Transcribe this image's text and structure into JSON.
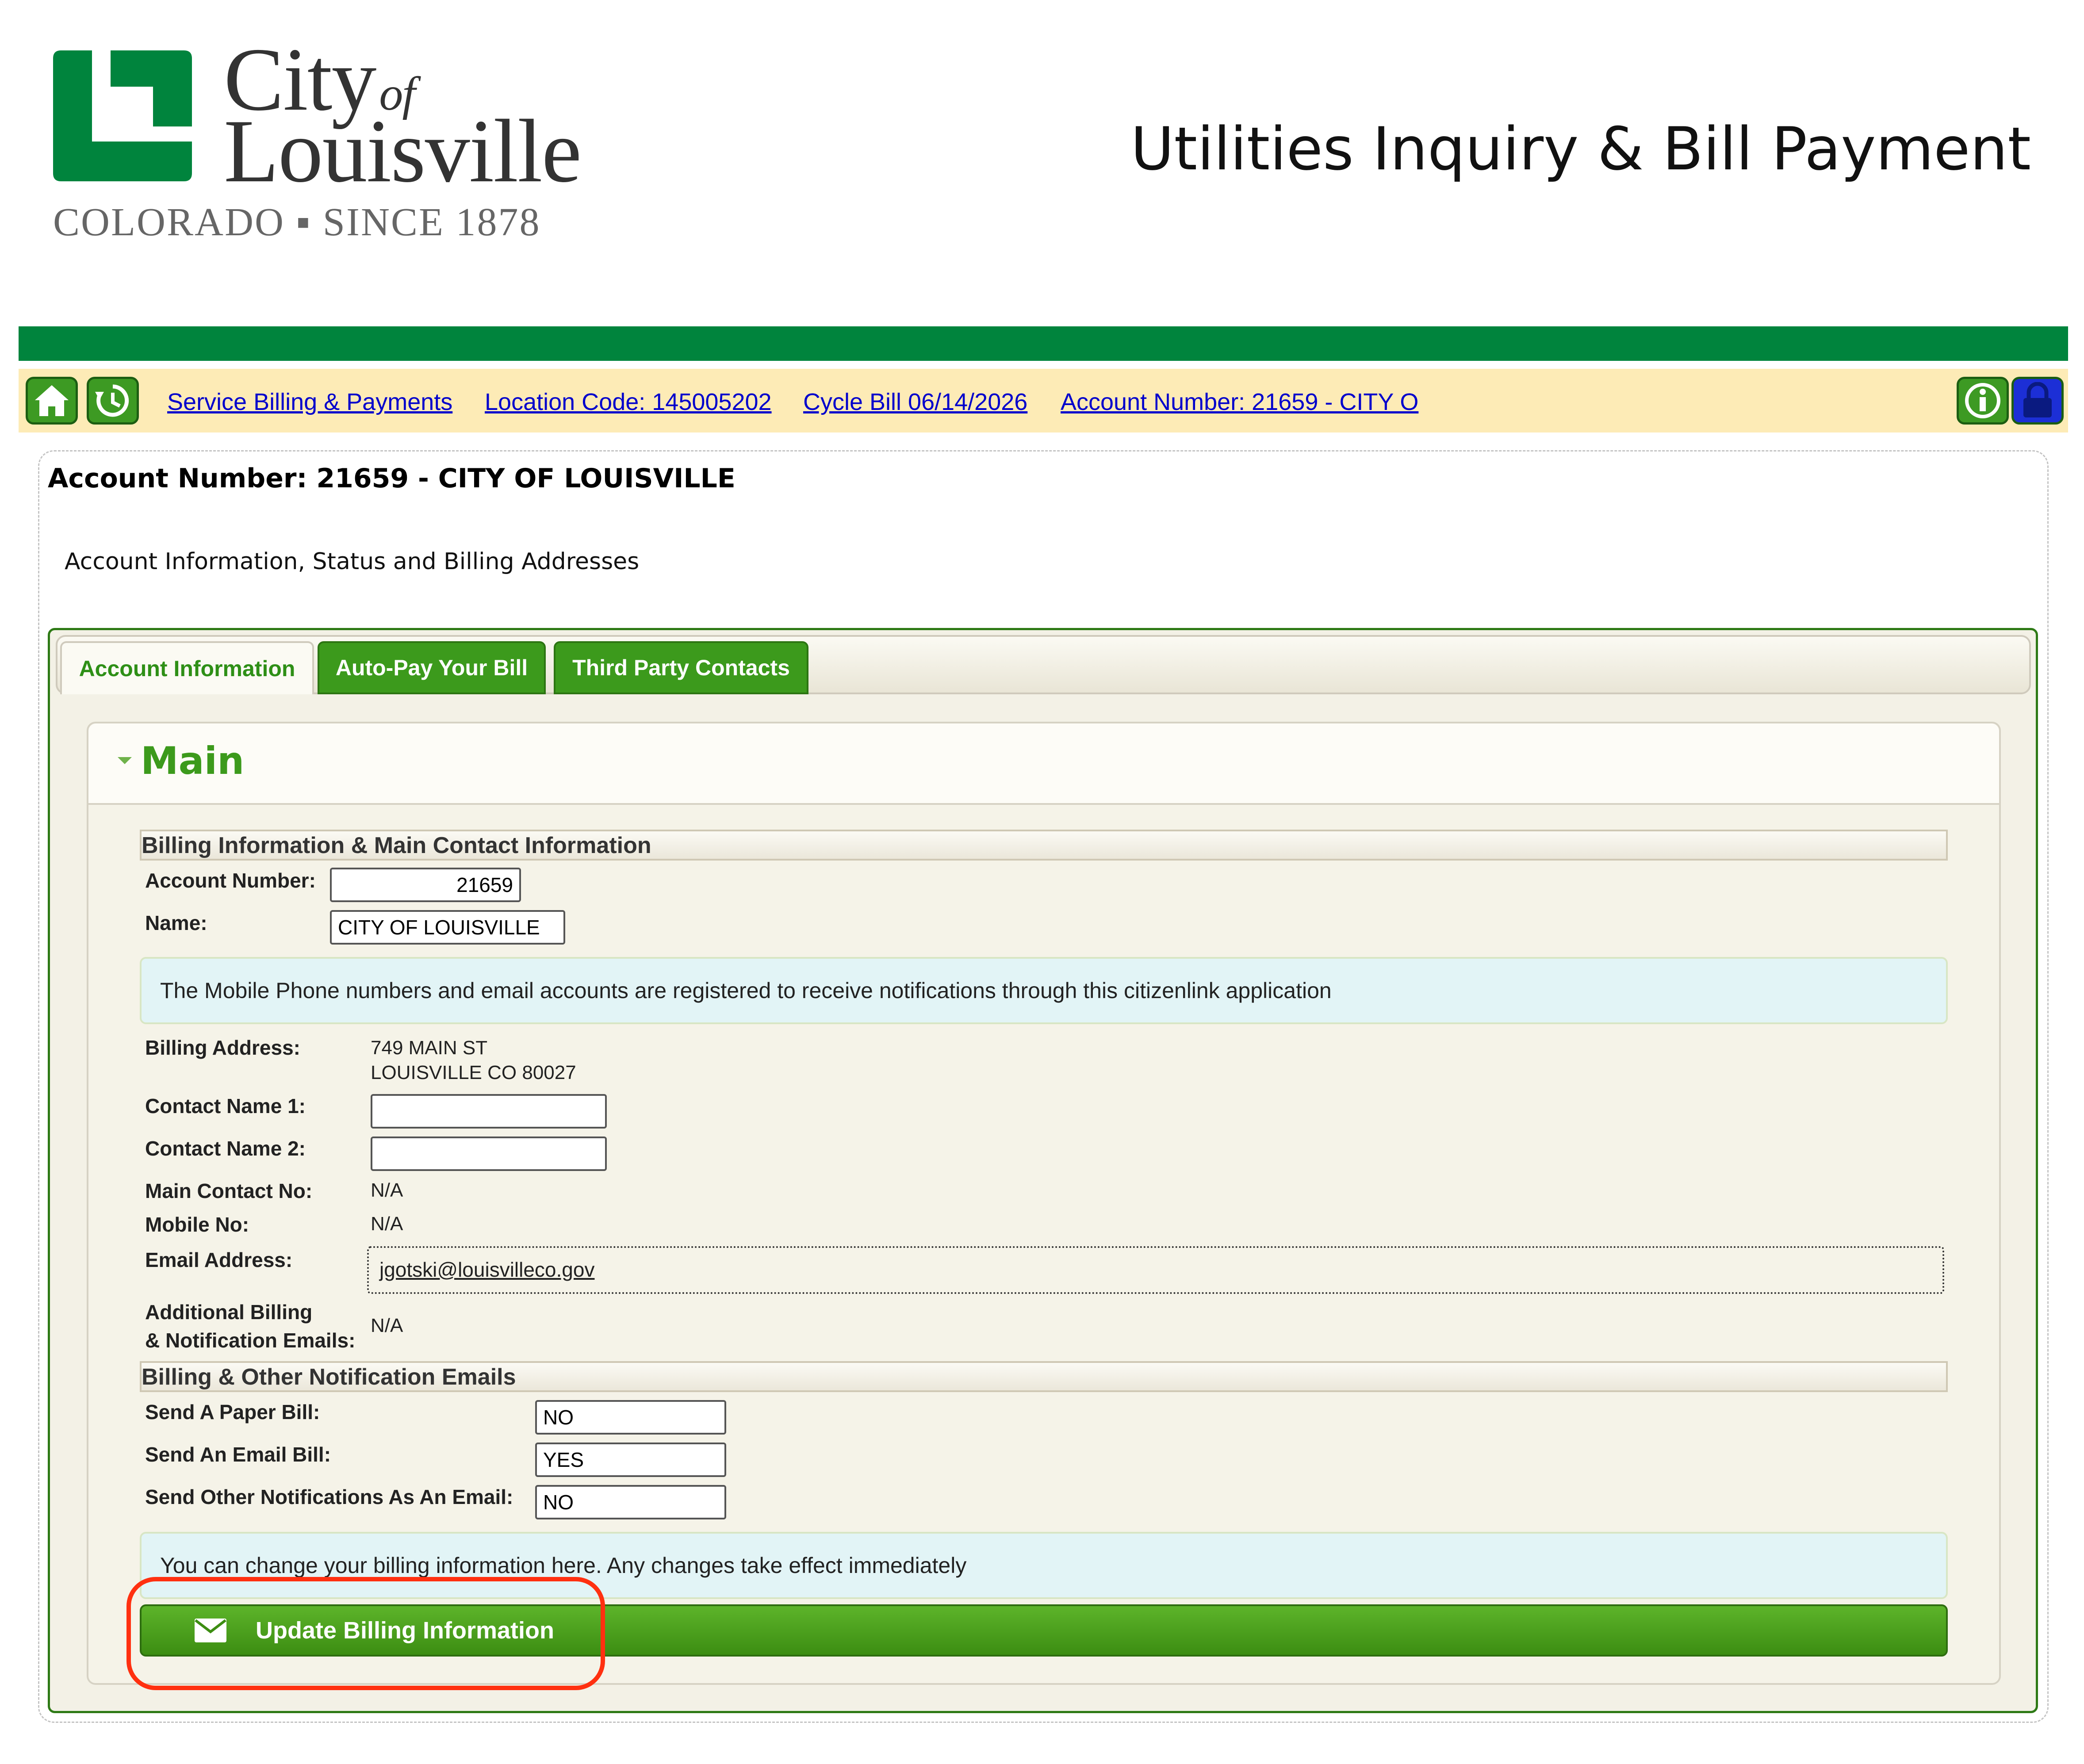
{
  "header": {
    "logo_city": "City",
    "logo_of": "of",
    "logo_louisville": "Louisville",
    "logo_tagline": "COLORADO ▪ SINCE 1878",
    "site_title": "Utilities Inquiry & Bill Payment"
  },
  "toolbar": {
    "home_icon": "home-icon",
    "history_icon": "history-icon",
    "info_icon": "info-icon",
    "lock_icon": "lock-icon",
    "crumbs": [
      "Service Billing & Payments",
      "Location Code: 145005202",
      "Cycle Bill 06/14/2026",
      "Account Number: 21659 - CITY O"
    ]
  },
  "account": {
    "heading": "Account Number: 21659 - CITY OF LOUISVILLE",
    "subheading": "Account Information, Status and Billing Addresses"
  },
  "tabs": [
    "Account Information",
    "Auto-Pay Your Bill",
    "Third Party Contacts"
  ],
  "main": {
    "title": "Main",
    "billing_section_title": "Billing Information & Main Contact Information",
    "labels": {
      "account_number": "Account Number:",
      "name": "Name:",
      "billing_address": "Billing Address:",
      "contact_name_1": "Contact Name 1:",
      "contact_name_2": "Contact Name 2:",
      "main_contact_no": "Main Contact No:",
      "mobile_no": "Mobile No:",
      "email_address": "Email Address:",
      "additional_line1": "Additional Billing",
      "additional_line2": "& Notification Emails:"
    },
    "values": {
      "account_number": "21659",
      "name": "CITY OF LOUISVILLE",
      "billing_address_line1": "749 MAIN ST",
      "billing_address_line2": "LOUISVILLE CO 80027",
      "contact_name_1": "",
      "contact_name_2": "",
      "main_contact_no": "N/A",
      "mobile_no": "N/A",
      "email_address": "jgotski@louisvilleco.gov",
      "additional_emails": "N/A"
    },
    "notice_text": "The Mobile Phone numbers and email accounts are registered to receive notifications through this citizenlink application",
    "notify_section_title": "Billing & Other Notification Emails",
    "notify_labels": {
      "paper_bill": "Send A Paper Bill:",
      "email_bill": "Send An Email Bill:",
      "other_notifications": "Send Other Notifications As An Email:"
    },
    "notify_values": {
      "paper_bill": "NO",
      "email_bill": "YES",
      "other_notifications": "NO"
    },
    "change_notice": "You can change your billing information here. Any changes take effect immediately",
    "update_button_label": "Update Billing Information",
    "update_button_icon": "envelope-icon"
  },
  "colors": {
    "brand_green": "#00843d",
    "toolbar_bg": "#fdebb6",
    "button_green": "#3c9a1c",
    "highlight_red": "#ff3010"
  }
}
